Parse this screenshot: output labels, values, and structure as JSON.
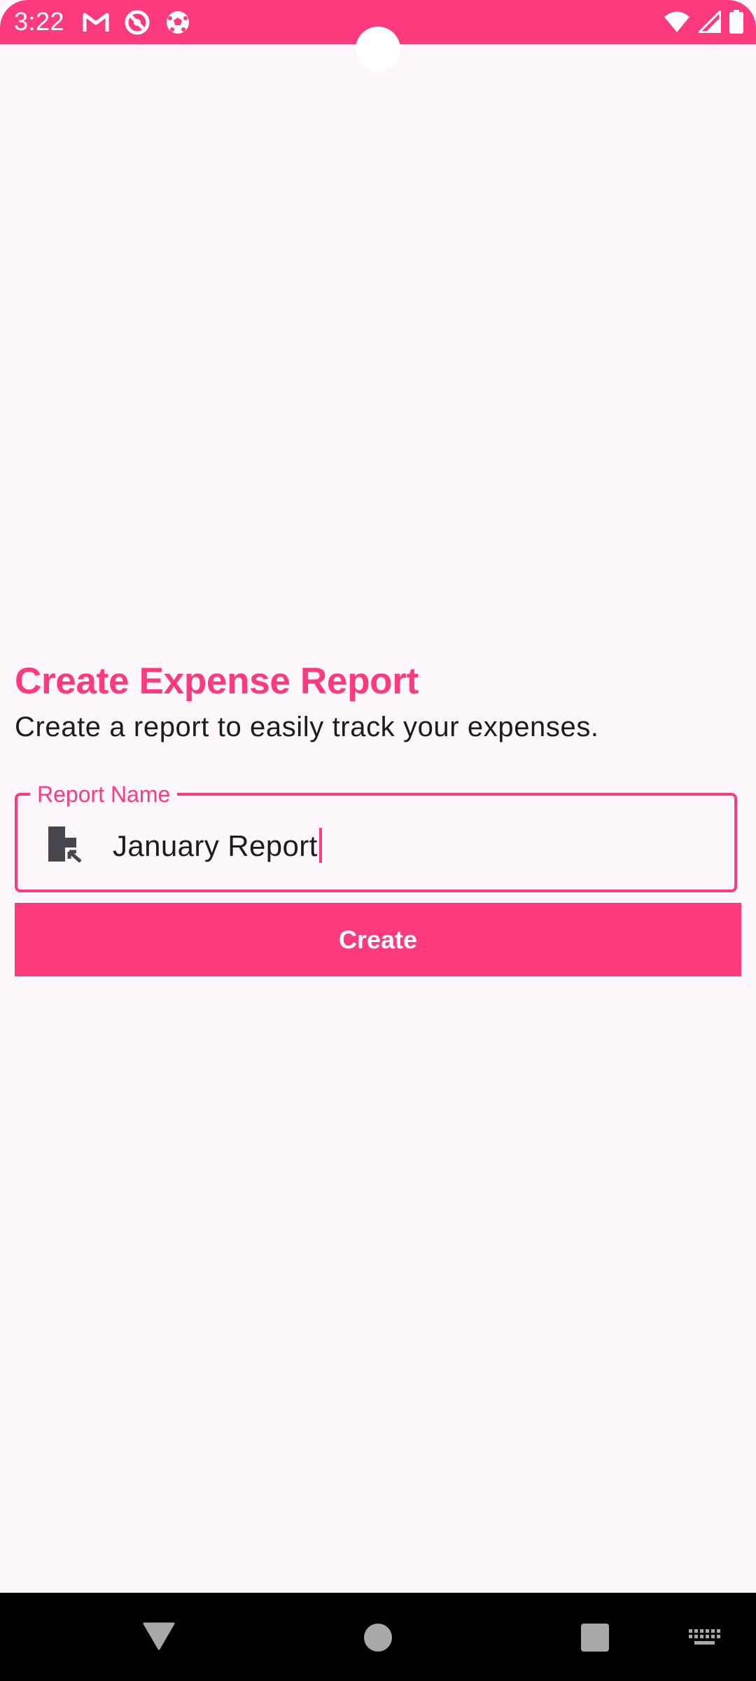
{
  "status_bar": {
    "time": "3:22",
    "left_icons": [
      "gmail-icon",
      "do-not-disturb-icon",
      "soccer-ball-icon"
    ],
    "right_icons": [
      "wifi-icon",
      "cell-signal-icon",
      "battery-icon"
    ],
    "background": "#fd3a7d"
  },
  "main": {
    "title": "Create Expense Report",
    "subtitle": "Create a report to easily track your expenses.",
    "report_field": {
      "label": "Report Name",
      "value": "January Report",
      "icon": "file-open-icon"
    },
    "create_button_label": "Create"
  },
  "nav_bar": {
    "buttons": [
      "back-icon",
      "home-icon",
      "recents-icon",
      "keyboard-icon"
    ]
  },
  "colors": {
    "accent": "#fd3a7d",
    "background": "#fdf7fb",
    "text": "#1c1b1f"
  }
}
